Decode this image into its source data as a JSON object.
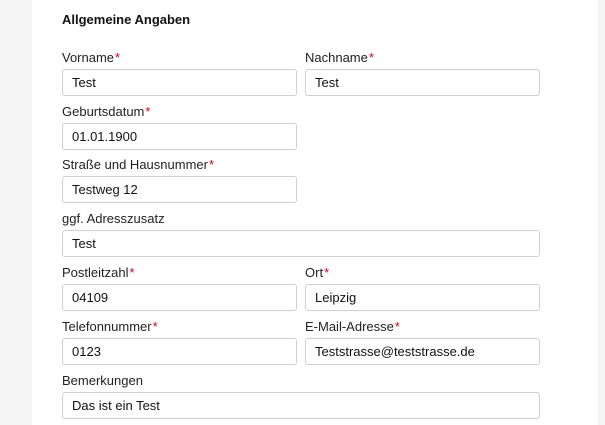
{
  "section": {
    "title": "Allgemeine Angaben"
  },
  "required_marker": "*",
  "fields": {
    "vorname": {
      "label": "Vorname",
      "value": "Test",
      "required": true
    },
    "nachname": {
      "label": "Nachname",
      "value": "Test",
      "required": true
    },
    "geburtsdatum": {
      "label": "Geburtsdatum",
      "value": "01.01.1900",
      "required": true
    },
    "strasse": {
      "label": "Straße und Hausnummer",
      "value": "Testweg 12",
      "required": true
    },
    "adresszusatz": {
      "label": "ggf. Adresszusatz",
      "value": "Test",
      "required": false
    },
    "plz": {
      "label": "Postleitzahl",
      "value": "04109",
      "required": true
    },
    "ort": {
      "label": "Ort",
      "value": "Leipzig",
      "required": true
    },
    "telefon": {
      "label": "Telefonnummer",
      "value": "0123",
      "required": true
    },
    "email": {
      "label": "E-Mail-Adresse",
      "value": "Teststrasse@teststrasse.de",
      "required": true
    },
    "bemerkungen": {
      "label": "Bemerkungen",
      "value": "Das ist ein Test",
      "required": false
    }
  },
  "colors": {
    "required": "#d0021b",
    "border": "#cfcfcf",
    "background": "#f5f5f5"
  }
}
